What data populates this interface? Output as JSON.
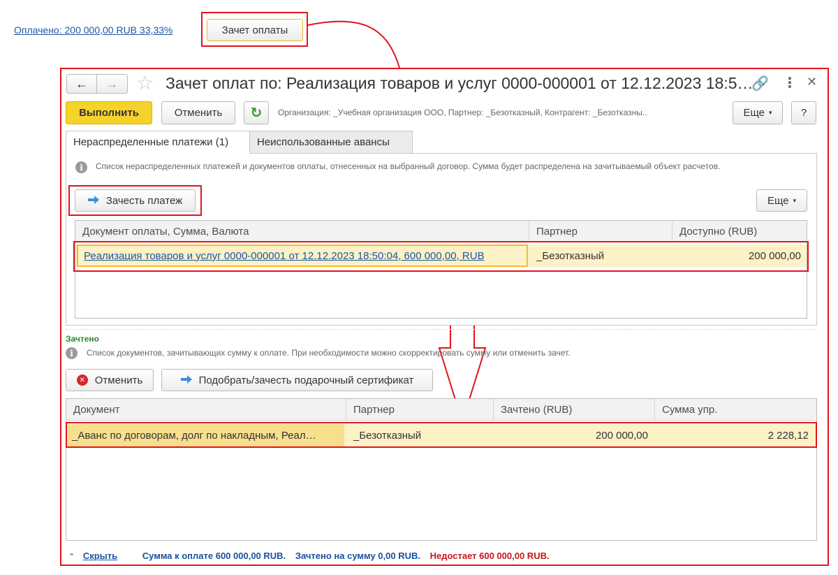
{
  "top": {
    "paid_link": "Оплачено: 200 000,00 RUB 33,33%",
    "offset_button": "Зачет оплаты"
  },
  "window": {
    "title": "Зачет оплат по: Реализация товаров и услуг 0000-000001 от 12.12.2023 18:5…",
    "toolbar": {
      "execute": "Выполнить",
      "cancel": "Отменить",
      "org_info": "Организация: _Учебная организация ООО, Партнер: _Безотказный, Контрагент: _Безотказны..",
      "more": "Еще",
      "help": "?"
    },
    "tabs": [
      {
        "label": "Нераспределенные платежи (1)"
      },
      {
        "label": "Неиспользованные авансы"
      }
    ],
    "unallocated": {
      "hint": "Список нераспределенных платежей и документов оплаты, отнесенных на выбранный договор. Сумма будет распределена на зачитываемый объект расчетов.",
      "offset_payment_button": "Зачесть платеж",
      "more": "Еще",
      "columns": [
        "Документ оплаты, Сумма, Валюта",
        "Партнер",
        "Доступно (RUB)"
      ],
      "rows": [
        {
          "document": "Реализация товаров и услуг 0000-000001 от 12.12.2023 18:50:04, 600 000,00, RUB",
          "partner": "_Безотказный",
          "available": "200 000,00"
        }
      ]
    },
    "offset": {
      "section_title": "Зачтено",
      "hint": "Список документов, зачитывающих сумму к оплате. При необходимости можно скорректировать сумму или отменить зачет.",
      "cancel_button": "Отменить",
      "gift_button": "Подобрать/зачесть подарочный сертификат",
      "columns": [
        "Документ",
        "Партнер",
        "Зачтено (RUB)",
        "Сумма упр."
      ],
      "rows": [
        {
          "document": "_Аванс по договорам, долг по накладным, Реал…",
          "partner": "_Безотказный",
          "offset": "200 000,00",
          "sum_mgmt": "2 228,12"
        }
      ]
    },
    "footer": {
      "hide_link": "Скрыть",
      "sum_to_pay": "Сумма к оплате 600 000,00 RUB.",
      "offset_sum": "Зачтено на сумму 0,00 RUB.",
      "shortage": "Недостает 600 000,00 RUB."
    }
  },
  "colors": {
    "annotation_red": "#e2141c",
    "execute_yellow": "#f5d32a",
    "row_highlight": "#fdf1c6",
    "link_blue": "#1b57a5",
    "section_green": "#2c8a2c",
    "footer_blue": "#1a4fa0",
    "footer_red": "#c8141a"
  }
}
